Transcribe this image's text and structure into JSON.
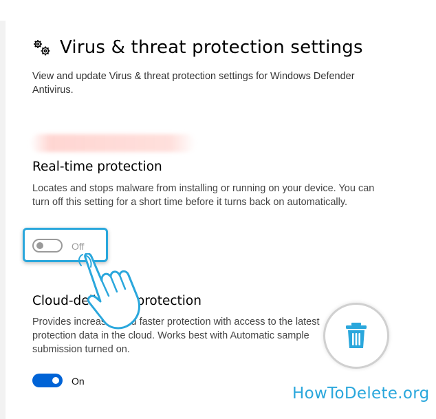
{
  "page": {
    "title": "Virus & threat protection settings",
    "description": "View and update Virus & threat protection settings for Windows Defender Antivirus."
  },
  "realtime": {
    "title": "Real-time protection",
    "description": "Locates and stops malware from installing or running on your device. You can turn off this setting for a short time before it turns back on automatically.",
    "toggle_state": "Off"
  },
  "cloud": {
    "title": "Cloud-delivered protection",
    "description": "Provides increased and faster protection with access to the latest protection data in the cloud. Works best with Automatic sample submission turned on.",
    "toggle_state": "On"
  },
  "overlay": {
    "brand": "HowToDelete.org",
    "icons": [
      "gears-icon",
      "pointing-hand-icon",
      "trash-icon"
    ]
  },
  "colors": {
    "accent_blue": "#0063d6",
    "highlight": "#2aa7dc",
    "brand": "#2aa7dc",
    "toggle_off": "#9a9a9a"
  }
}
